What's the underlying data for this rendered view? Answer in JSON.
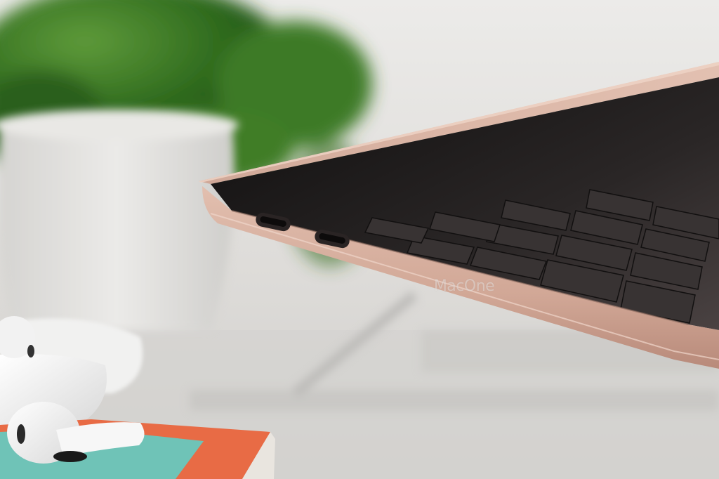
{
  "photo": {
    "subject": "laptop-side-view",
    "watermark": "MacOne",
    "colors": {
      "background": "#d9d8d5",
      "wall": "#e8e8e6",
      "table": "#d2d1ce",
      "plant_green": "#2f6b1e",
      "pot_white": "#e2e1de",
      "laptop_gold": "#d6b0a0",
      "laptop_edge": "#c49585",
      "keyboard_dark": "#1e1c1c",
      "earbuds_white": "#f4f4f4",
      "book_orange": "#e86b45",
      "book_teal": "#6fc3b7"
    }
  }
}
